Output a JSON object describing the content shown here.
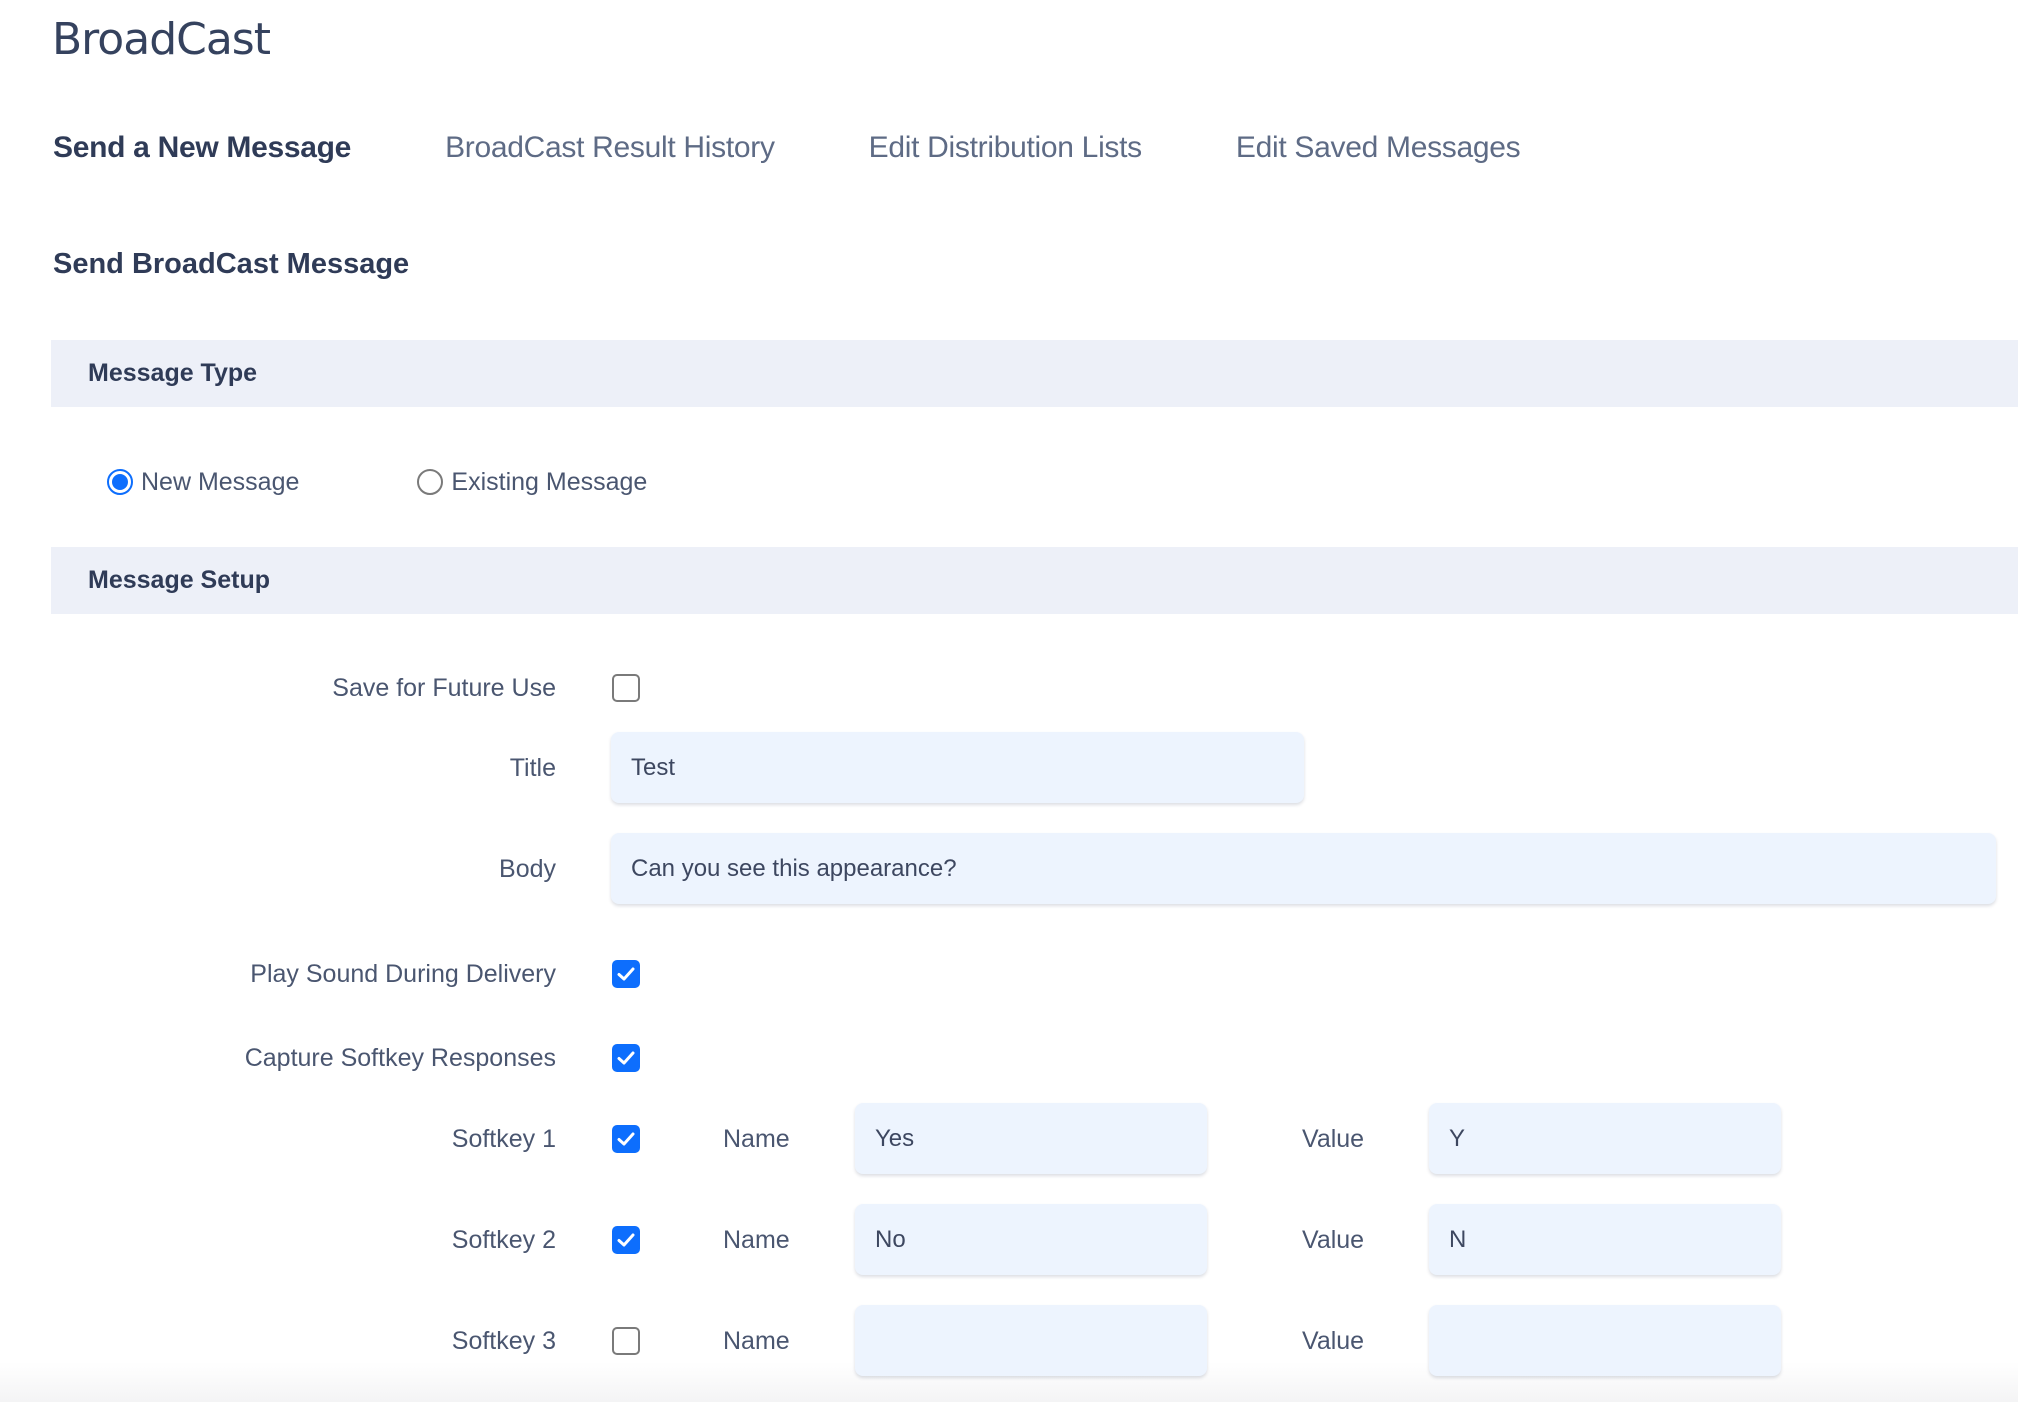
{
  "app": {
    "title": "BroadCast"
  },
  "tabs": [
    {
      "label": "Send a New Message",
      "active": true
    },
    {
      "label": "BroadCast Result History",
      "active": false
    },
    {
      "label": "Edit Distribution Lists",
      "active": false
    },
    {
      "label": "Edit Saved Messages",
      "active": false
    }
  ],
  "page": {
    "section_title": "Send BroadCast Message"
  },
  "message_type": {
    "header": "Message Type",
    "options": [
      {
        "label": "New Message",
        "selected": true
      },
      {
        "label": "Existing Message",
        "selected": false
      }
    ]
  },
  "message_setup": {
    "header": "Message Setup",
    "save_for_future_use": {
      "label": "Save for Future Use",
      "checked": false
    },
    "title": {
      "label": "Title",
      "value": "Test"
    },
    "body": {
      "label": "Body",
      "value": "Can you see this appearance?"
    },
    "play_sound": {
      "label": "Play Sound During Delivery",
      "checked": true
    },
    "capture_softkey": {
      "label": "Capture Softkey Responses",
      "checked": true
    },
    "name_label": "Name",
    "value_label": "Value",
    "softkeys": [
      {
        "label": "Softkey 1",
        "checked": true,
        "name": "Yes",
        "value": "Y"
      },
      {
        "label": "Softkey 2",
        "checked": true,
        "name": "No",
        "value": "N"
      },
      {
        "label": "Softkey 3",
        "checked": false,
        "name": "",
        "value": ""
      }
    ]
  },
  "colors": {
    "accent": "#0d6efd",
    "section_bar": "#edf0f8",
    "input_bg": "#edf4fe",
    "text_dark": "#2f3b57"
  }
}
